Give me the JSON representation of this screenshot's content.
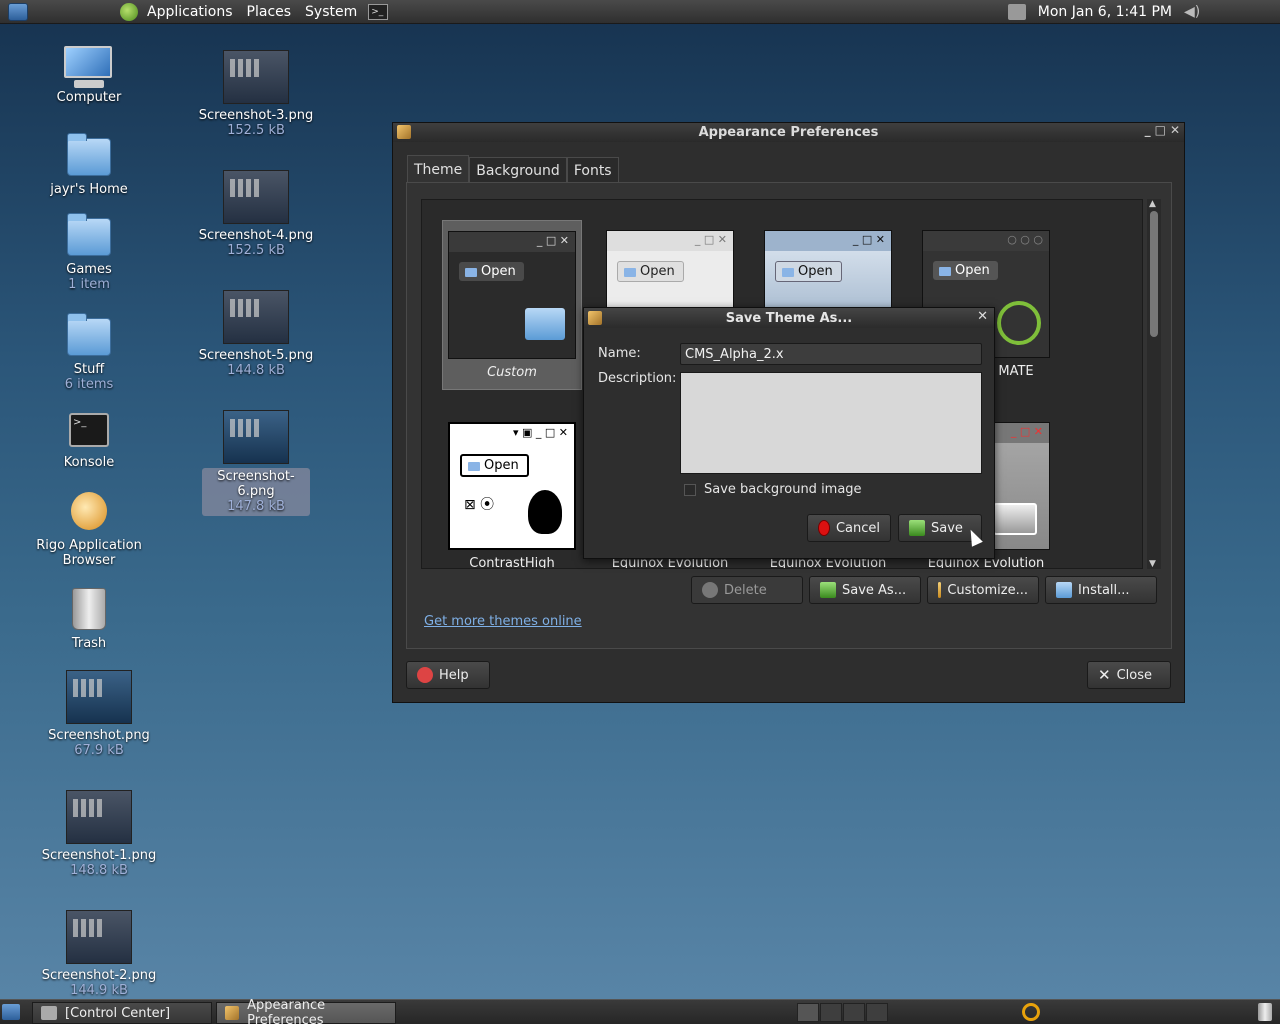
{
  "top_panel": {
    "menus": [
      "Applications",
      "Places",
      "System"
    ],
    "clock": "Mon Jan  6,  1:41 PM"
  },
  "desktop": {
    "icons": [
      {
        "label": "Computer",
        "sub": ""
      },
      {
        "label": "jayr's Home",
        "sub": ""
      },
      {
        "label": "Games",
        "sub": "1 item"
      },
      {
        "label": "Stuff",
        "sub": "6 items"
      },
      {
        "label": "Konsole",
        "sub": ""
      },
      {
        "label": "Rigo Application Browser",
        "sub": ""
      },
      {
        "label": "Trash",
        "sub": ""
      },
      {
        "label": "Screenshot.png",
        "sub": "67.9 kB"
      },
      {
        "label": "Screenshot-1.png",
        "sub": "148.8 kB"
      },
      {
        "label": "Screenshot-2.png",
        "sub": "144.9 kB"
      },
      {
        "label": "Screenshot-3.png",
        "sub": "152.5 kB"
      },
      {
        "label": "Screenshot-4.png",
        "sub": "152.5 kB"
      },
      {
        "label": "Screenshot-5.png",
        "sub": "144.8 kB"
      },
      {
        "label": "Screenshot-6.png",
        "sub": "147.8 kB"
      }
    ]
  },
  "appearance": {
    "title": "Appearance Preferences",
    "tabs": [
      "Theme",
      "Background",
      "Fonts"
    ],
    "themes": [
      {
        "name": "Custom",
        "open": "Open"
      },
      {
        "name": "",
        "open": "Open"
      },
      {
        "name": "",
        "open": "Open"
      },
      {
        "name": "MATE",
        "open": "Open"
      },
      {
        "name": "ContrastHigh",
        "open": "Open"
      },
      {
        "name": "Equinox Evolution",
        "open": ""
      },
      {
        "name": "Equinox Evolution",
        "open": ""
      },
      {
        "name": "Equinox Evolution",
        "open": ""
      }
    ],
    "buttons": {
      "delete": "Delete",
      "save_as": "Save As...",
      "customize": "Customize...",
      "install": "Install...",
      "help": "Help",
      "close": "Close"
    },
    "link": "Get more themes online"
  },
  "dialog": {
    "title": "Save Theme As...",
    "name_label": "Name:",
    "name_value": "CMS_Alpha_2.x",
    "description_label": "Description:",
    "checkbox_label": "Save background image",
    "cancel": "Cancel",
    "save": "Save"
  },
  "taskbar": {
    "tasks": [
      "[Control Center]",
      "Appearance Preferences"
    ]
  }
}
